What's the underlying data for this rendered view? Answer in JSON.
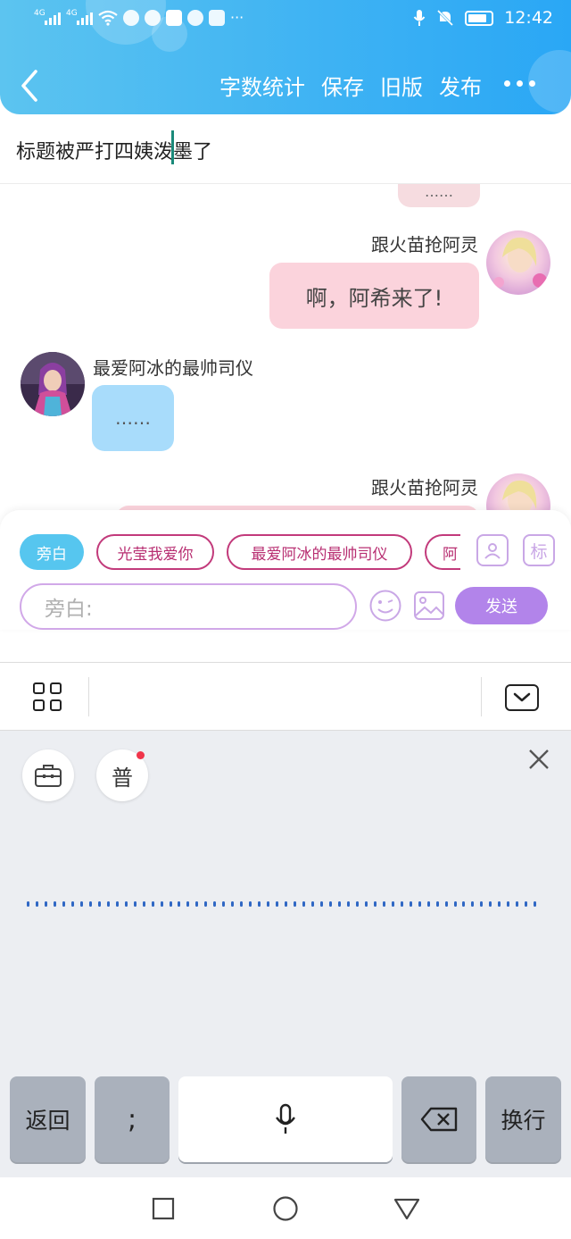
{
  "status_bar": {
    "net1": "4G",
    "net2": "4G",
    "time": "12:42"
  },
  "nav": {
    "actions": [
      "字数统计",
      "保存",
      "旧版",
      "发布"
    ]
  },
  "title": {
    "text": "标题被严打四姨泼墨了"
  },
  "chat": {
    "partial_top_text": "……",
    "messages": [
      {
        "side": "right",
        "name": "跟火苗抢阿灵",
        "text": "啊，阿希来了!"
      },
      {
        "side": "left",
        "name": "最爱阿冰的最帅司仪",
        "text": "……"
      },
      {
        "side": "right",
        "name": "跟火苗抢阿灵",
        "text": ""
      }
    ]
  },
  "composer": {
    "chips": [
      "旁白",
      "光莹我爱你",
      "最爱阿冰的最帅司仪",
      "阿"
    ],
    "label_button": "标",
    "input_placeholder": "旁白:",
    "send_label": "发送"
  },
  "voice_panel": {
    "mode_label": "普"
  },
  "keys": {
    "back": "返回",
    "semicolon": ";",
    "newline": "换行"
  },
  "colors": {
    "header": "#3fb3f3",
    "bubble_pink": "#fbd3dc",
    "bubble_blue": "#a8dcfb",
    "chip_active": "#56c6ef",
    "chip_role": "#c23a7b",
    "send_button": "#b284ea",
    "voice_panel_bg": "#eceef2",
    "key_gray": "#aab1bc"
  }
}
